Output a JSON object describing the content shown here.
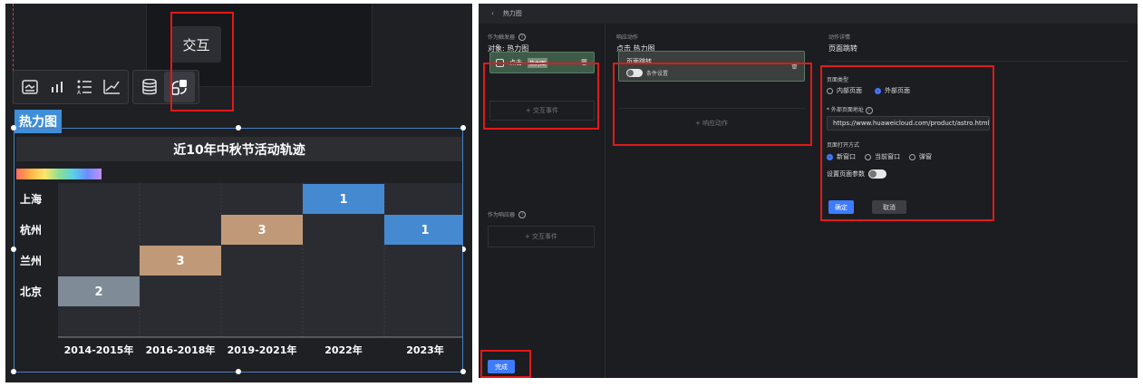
{
  "left_panel": {
    "tooltip": "交互",
    "tag": "热力图",
    "toolbar_icons": [
      "image-icon",
      "bar-chart-icon",
      "list-icon",
      "axis-icon",
      "database-icon",
      "interaction-icon"
    ]
  },
  "chart_data": {
    "type": "heatmap",
    "title": "近10年中秋节活动轨迹",
    "x_categories": [
      "2014-2015年",
      "2016-2018年",
      "2019-2021年",
      "2022年",
      "2023年"
    ],
    "y_categories": [
      "上海",
      "杭州",
      "兰州",
      "北京"
    ],
    "cells": [
      {
        "x": "2022年",
        "y": "上海",
        "value": 1,
        "color": "#4589d1"
      },
      {
        "x": "2019-2021年",
        "y": "杭州",
        "value": 3,
        "color": "#c09a78"
      },
      {
        "x": "2023年",
        "y": "杭州",
        "value": 1,
        "color": "#4589d1"
      },
      {
        "x": "2016-2018年",
        "y": "兰州",
        "value": 3,
        "color": "#c09a78"
      },
      {
        "x": "2014-2015年",
        "y": "北京",
        "value": 2,
        "color": "#7f8b97"
      }
    ]
  },
  "right_panel": {
    "breadcrumb": "热力图",
    "back_icon": "chevron-left-icon",
    "trigger": {
      "label": "作为触发器",
      "value": "对象: 热力图",
      "card_text": "点击",
      "card_tag": "热力图",
      "add_event": "+ 交互事件"
    },
    "receiver": {
      "label": "作为响应器",
      "add_event": "+ 交互事件"
    },
    "response": {
      "label": "响应动作",
      "value": "点击 热力图",
      "card_title": "页面跳转",
      "card_condition": "条件设置",
      "add_action": "+ 响应动作"
    },
    "detail": {
      "label": "动作详情",
      "value": "页面跳转",
      "page_type_label": "页面类型",
      "page_type_options": [
        "内部页面",
        "外部页面"
      ],
      "page_type_selected": "外部页面",
      "url_label": "* 外部页面地址",
      "url_value": "https://www.huaweicloud.com/product/astro.html",
      "open_mode_label": "页面打开方式",
      "open_mode_options": [
        "新窗口",
        "当前窗口",
        "弹窗"
      ],
      "open_mode_selected": "新窗口",
      "param_label": "设置页面参数",
      "confirm": "确定",
      "cancel": "取消"
    },
    "done": "完成"
  }
}
